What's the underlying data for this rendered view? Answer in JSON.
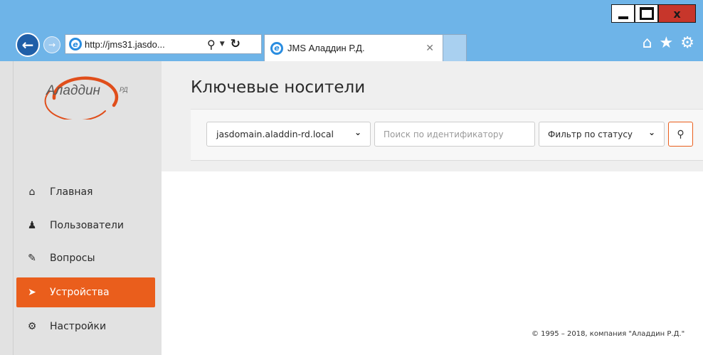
{
  "browser": {
    "address": "http://jms31.jasdo...",
    "tab_title": "JMS Аладдин Р.Д.",
    "window_close_label": "x"
  },
  "logo": {
    "name": "Аладдин",
    "superscript": "РД"
  },
  "sidebar": {
    "items": [
      {
        "label": "Главная",
        "icon": "home-icon"
      },
      {
        "label": "Пользователи",
        "icon": "user-icon"
      },
      {
        "label": "Вопросы",
        "icon": "edit-icon"
      },
      {
        "label": "Устройства",
        "icon": "tags-icon",
        "active": true
      },
      {
        "label": "Настройки",
        "icon": "gear-icon"
      }
    ]
  },
  "main": {
    "title": "Ключевые носители",
    "filters": {
      "domain_value": "jasdomain.aladdin-rd.local",
      "search_placeholder": "Поиск по идентификатору",
      "status_value": "Фильтр по статусу"
    }
  },
  "footer": {
    "copyright": "© 1995 – 2018, компания \"Аладдин Р.Д.\""
  },
  "colors": {
    "accent": "#ea5e1c",
    "titlebar": "#6eb4e8",
    "sidebar_bg": "#e2e2e2"
  }
}
